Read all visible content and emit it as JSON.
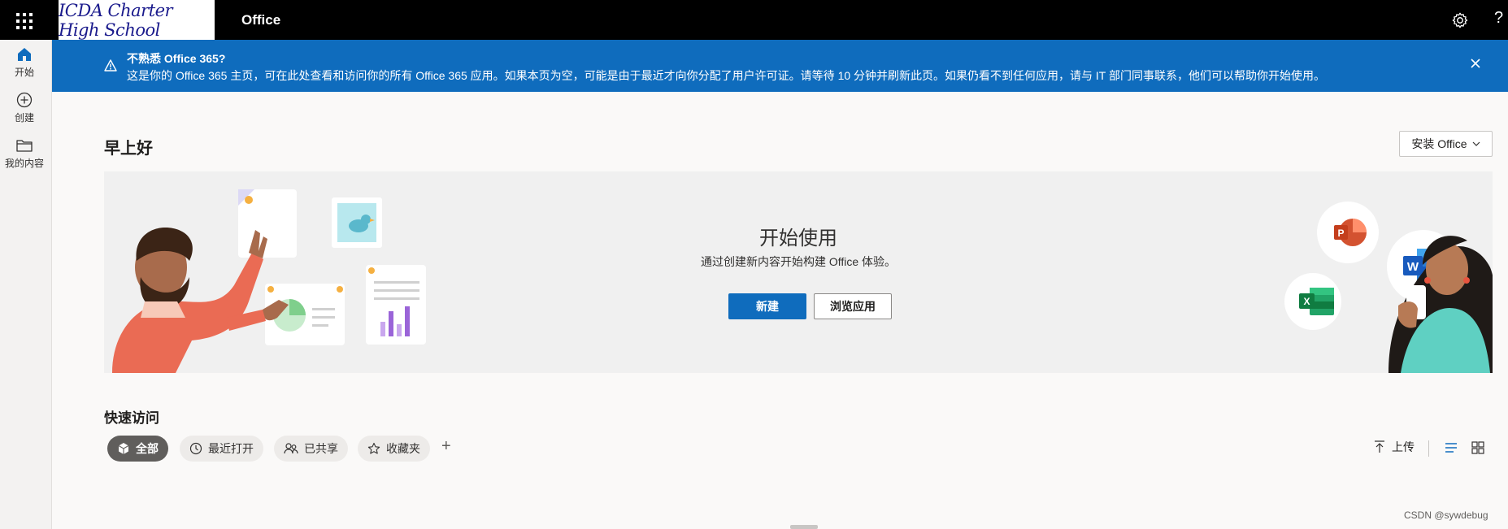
{
  "header": {
    "org_name": "ICDA Charter High School",
    "app_name": "Office",
    "help_symbol": "?"
  },
  "nav": {
    "items": [
      {
        "label": "开始",
        "icon": "home-icon"
      },
      {
        "label": "创建",
        "icon": "create-plus-icon"
      },
      {
        "label": "我的内容",
        "icon": "folder-icon"
      }
    ]
  },
  "banner": {
    "title": "不熟悉 Office 365?",
    "message": "这是你的 Office 365 主页，可在此处查看和访问你的所有 Office 365 应用。如果本页为空，可能是由于最近才向你分配了用户许可证。请等待 10 分钟并刷新此页。如果仍看不到任何应用，请与 IT 部门同事联系，他们可以帮助你开始使用。"
  },
  "main": {
    "greeting": "早上好",
    "install_label": "安装 Office"
  },
  "hero": {
    "title": "开始使用",
    "subtitle": "通过创建新内容开始构建 Office 体验。",
    "new_label": "新建",
    "browse_label": "浏览应用",
    "app_icons": [
      "powerpoint-icon",
      "word-icon",
      "excel-icon"
    ]
  },
  "quick_access": {
    "title": "快速访问",
    "filters": [
      {
        "label": "全部",
        "icon": "cube-icon",
        "active": true
      },
      {
        "label": "最近打开",
        "icon": "clock-icon",
        "active": false
      },
      {
        "label": "已共享",
        "icon": "people-icon",
        "active": false
      },
      {
        "label": "收藏夹",
        "icon": "star-icon",
        "active": false
      }
    ],
    "add_symbol": "+",
    "upload_label": "上传"
  },
  "footer": {
    "watermark": "CSDN @sywdebug"
  },
  "colors": {
    "topbar": "#000000",
    "banner": "#0f6cbd",
    "primary_button": "#0f6cbd",
    "active_pill": "#605e5c"
  }
}
